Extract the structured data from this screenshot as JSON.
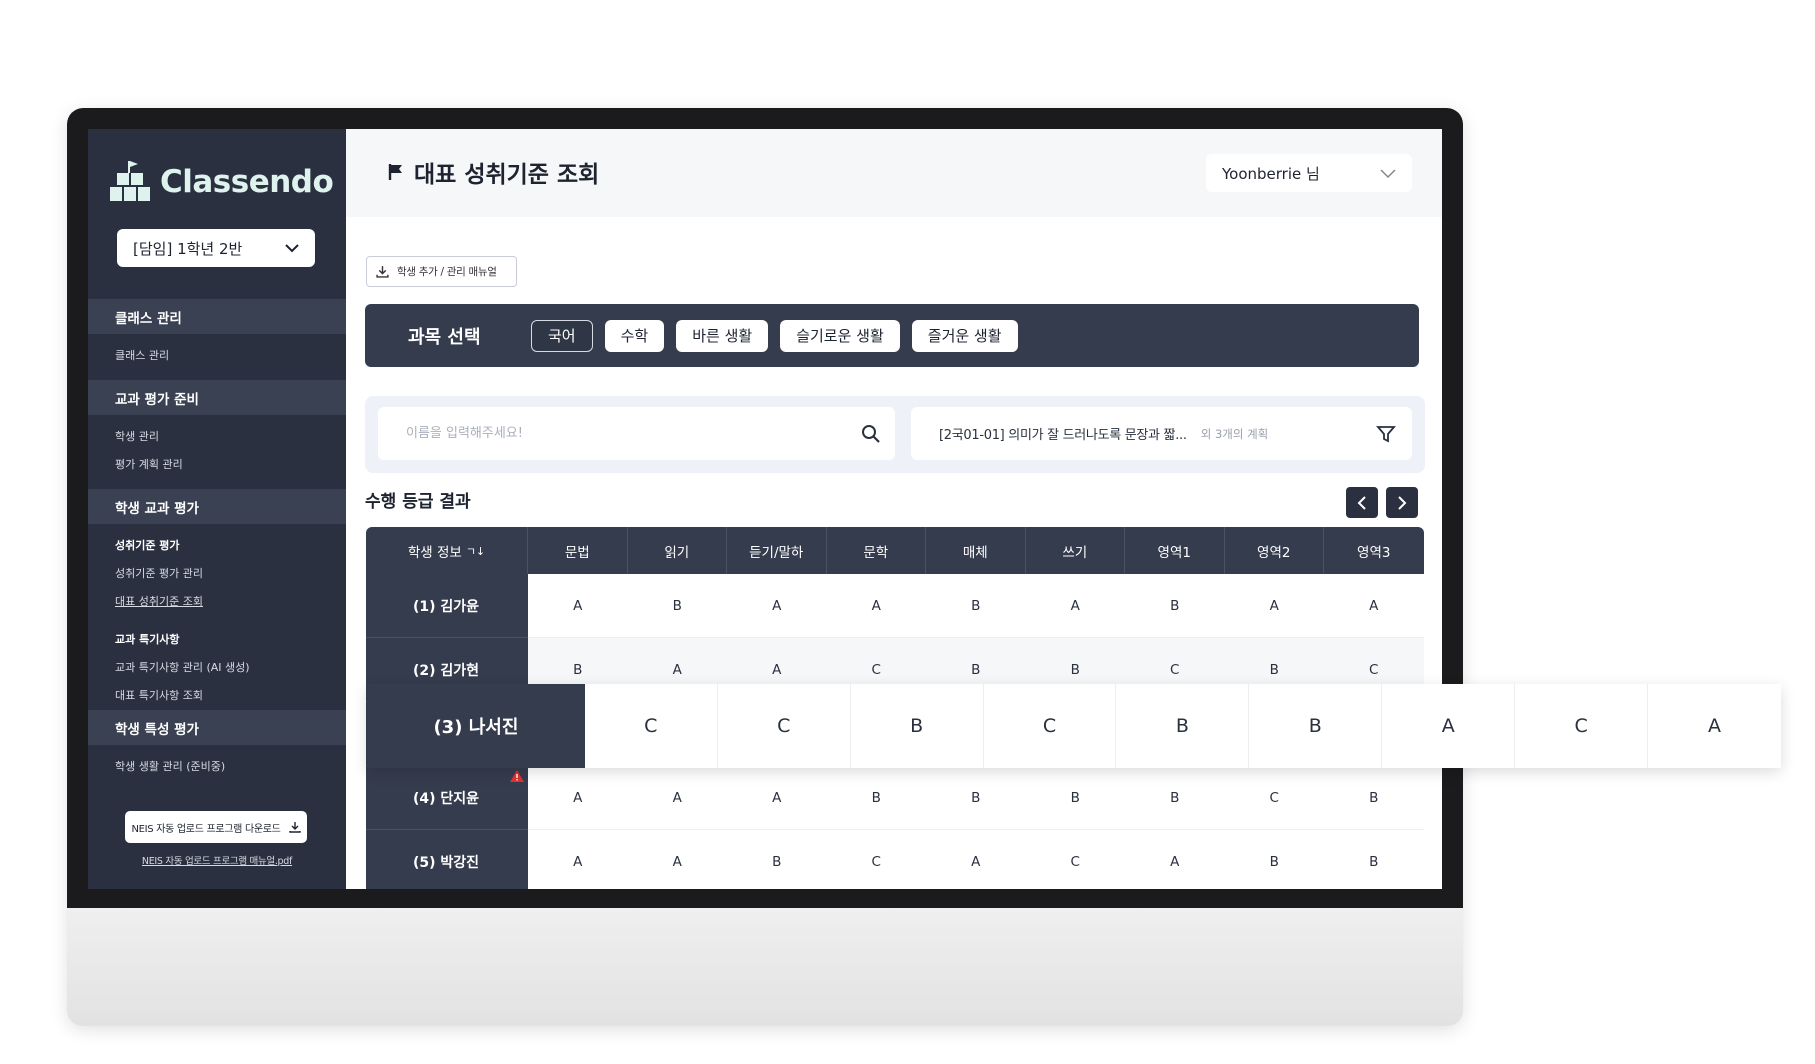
{
  "app": {
    "name": "Classendo"
  },
  "sidebar": {
    "class_select": "[담임] 1학년 2반",
    "sections": [
      {
        "title": "클래스 관리",
        "items": [
          "클래스 관리"
        ]
      },
      {
        "title": "교과 평가 준비",
        "items": [
          "학생 관리",
          "평가 계획 관리"
        ]
      },
      {
        "title": "학생 교과 평가",
        "sub1": "성취기준 평가",
        "sub1_items": [
          "성취기준 평가 관리",
          "대표 성취기준 조회"
        ],
        "sub2": "교과 특기사항",
        "sub2_items": [
          "교과 특기사항 관리 (AI 생성)",
          "대표 특기사항 조회"
        ]
      },
      {
        "title": "학생 특성 평가",
        "items": [
          "학생 생활 관리 (준비중)"
        ]
      }
    ],
    "neis_button": "NEIS 자동 업로드 프로그램 다운로드",
    "neis_link": "NEIS 자동 업로드 프로그램 매뉴얼.pdf"
  },
  "header": {
    "title": "대표 성취기준 조회",
    "user": "Yoonberrie 님"
  },
  "manual_button": "학생 추가 / 관리 매뉴얼",
  "subjects": {
    "label": "과목 선택",
    "items": [
      "국어",
      "수학",
      "바른 생활",
      "슬기로운 생활",
      "즐거운 생활"
    ],
    "active": "국어"
  },
  "search": {
    "placeholder": "이름을 입력해주세요!"
  },
  "plan": {
    "selected": "[2국01-01] 의미가 잘 드러나도록 문장과 짧...",
    "extra": "외 3개의 계획"
  },
  "results": {
    "title": "수행 등급 결과",
    "header": [
      "학생 정보",
      "문법",
      "읽기",
      "듣기/말하",
      "문학",
      "매체",
      "쓰기",
      "영역1",
      "영역2",
      "영역3"
    ],
    "rows": [
      {
        "name": "(1) 김가윤",
        "grades": [
          "A",
          "B",
          "A",
          "A",
          "B",
          "A",
          "B",
          "A",
          "A"
        ]
      },
      {
        "name": "(2) 김가현",
        "grades": [
          "B",
          "A",
          "A",
          "C",
          "B",
          "B",
          "C",
          "B",
          "C"
        ]
      },
      {
        "name": "(3) 나서진",
        "grades": [
          "C",
          "C",
          "B",
          "C",
          "B",
          "B",
          "A",
          "C",
          "A"
        ]
      },
      {
        "name": "(4) 단지윤",
        "grades": [
          "A",
          "A",
          "A",
          "B",
          "B",
          "B",
          "B",
          "C",
          "B"
        ]
      },
      {
        "name": "(5) 박강진",
        "grades": [
          "A",
          "A",
          "B",
          "C",
          "A",
          "C",
          "A",
          "B",
          "B"
        ]
      }
    ]
  },
  "colors": {
    "sidebar": "#2a303f",
    "header_row": "#353c4d",
    "logo": "#dff3ee",
    "warning": "#e03131"
  }
}
